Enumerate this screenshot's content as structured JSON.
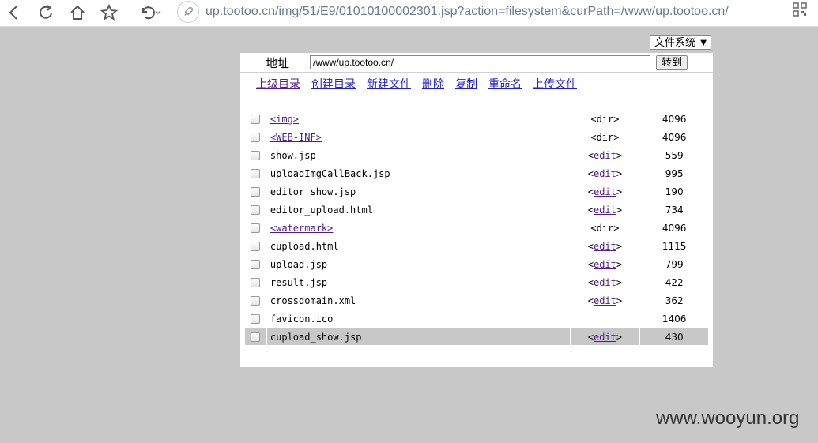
{
  "browser": {
    "url": "up.tootoo.cn/img/51/E9/01010100002301.jsp?action=filesystem&curPath=/www/up.tootoo.cn/"
  },
  "fs_select": {
    "value": "文件系统"
  },
  "address": {
    "label": "地址",
    "value": "/www/up.tootoo.cn/",
    "go_label": "转到"
  },
  "actions": [
    "上级目录",
    "创建目录",
    "新建文件",
    "删除",
    "复制",
    "重命名",
    "上传文件"
  ],
  "files": [
    {
      "name": "<img>",
      "kind": "dir",
      "type": "<dir>",
      "size": "4096"
    },
    {
      "name": "<WEB-INF>",
      "kind": "dir",
      "type": "<dir>",
      "size": "4096"
    },
    {
      "name": "show.jsp",
      "kind": "file",
      "type_pre": "<",
      "type_link": "edit",
      "type_post": ">",
      "size": "559"
    },
    {
      "name": "uploadImgCallBack.jsp",
      "kind": "file",
      "type_pre": "<",
      "type_link": "edit",
      "type_post": ">",
      "size": "995"
    },
    {
      "name": "editor_show.jsp",
      "kind": "file",
      "type_pre": "<",
      "type_link": "edit",
      "type_post": ">",
      "size": "190"
    },
    {
      "name": "editor_upload.html",
      "kind": "file",
      "type_pre": "<",
      "type_link": "edit",
      "type_post": ">",
      "size": "734"
    },
    {
      "name": "<watermark>",
      "kind": "dir",
      "type": "<dir>",
      "size": "4096"
    },
    {
      "name": "cupload.html",
      "kind": "file",
      "type_pre": "<",
      "type_link": "edit",
      "type_post": ">",
      "size": "1115"
    },
    {
      "name": "upload.jsp",
      "kind": "file",
      "type_pre": "<",
      "type_link": "edit",
      "type_post": ">",
      "size": "799"
    },
    {
      "name": "result.jsp",
      "kind": "file",
      "type_pre": "<",
      "type_link": "edit",
      "type_post": ">",
      "size": "422"
    },
    {
      "name": "crossdomain.xml",
      "kind": "file",
      "type_pre": "<",
      "type_link": "edit",
      "type_post": ">",
      "size": "362"
    },
    {
      "name": "favicon.ico",
      "kind": "plain",
      "size": "1406"
    },
    {
      "name": "cupload_show.jsp",
      "kind": "file",
      "type_pre": "<",
      "type_link": "edit",
      "type_post": ">",
      "size": "430",
      "highlight": true
    }
  ],
  "watermark": "www.wooyun.org",
  "colors": {
    "background": "#c8c8c8",
    "link": "#1f1fcc",
    "visited": "#551a8b"
  }
}
